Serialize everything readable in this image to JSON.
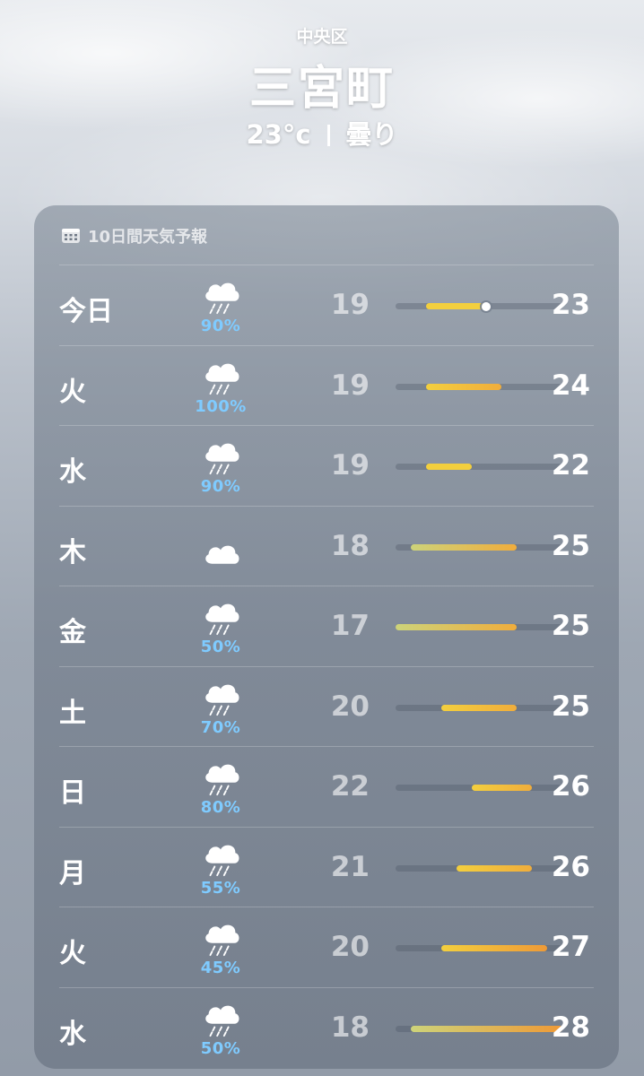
{
  "location": {
    "district": "中央区",
    "city": "三宮町",
    "temperature": "23°c",
    "condition": "曇り"
  },
  "forecast": {
    "title": "10日間天気予報",
    "icon": "calendar-icon",
    "range_min": 17,
    "range_max": 28,
    "current_temperature": 23,
    "days": [
      {
        "day": "今日",
        "icon": "cloud-rain-icon",
        "pop": "90%",
        "low": "19",
        "high": "23",
        "low_value": 19,
        "high_value": 23,
        "current": true
      },
      {
        "day": "火",
        "icon": "cloud-rain-icon",
        "pop": "100%",
        "low": "19",
        "high": "24",
        "low_value": 19,
        "high_value": 24
      },
      {
        "day": "水",
        "icon": "cloud-rain-icon",
        "pop": "90%",
        "low": "19",
        "high": "22",
        "low_value": 19,
        "high_value": 22
      },
      {
        "day": "木",
        "icon": "cloud-icon",
        "pop": "",
        "low": "18",
        "high": "25",
        "low_value": 18,
        "high_value": 25
      },
      {
        "day": "金",
        "icon": "cloud-rain-icon",
        "pop": "50%",
        "low": "17",
        "high": "25",
        "low_value": 17,
        "high_value": 25
      },
      {
        "day": "土",
        "icon": "cloud-rain-icon",
        "pop": "70%",
        "low": "20",
        "high": "25",
        "low_value": 20,
        "high_value": 25
      },
      {
        "day": "日",
        "icon": "cloud-rain-icon",
        "pop": "80%",
        "low": "22",
        "high": "26",
        "low_value": 22,
        "high_value": 26
      },
      {
        "day": "月",
        "icon": "cloud-rain-icon",
        "pop": "55%",
        "low": "21",
        "high": "26",
        "low_value": 21,
        "high_value": 26
      },
      {
        "day": "火",
        "icon": "cloud-rain-icon",
        "pop": "45%",
        "low": "20",
        "high": "27",
        "low_value": 20,
        "high_value": 27
      },
      {
        "day": "水",
        "icon": "cloud-rain-icon",
        "pop": "50%",
        "low": "18",
        "high": "28",
        "low_value": 18,
        "high_value": 28
      }
    ]
  },
  "colors": {
    "precipitation_text": "#7fcbff",
    "bar_cool": "#cdd37a",
    "bar_mild": "#f3cf3e",
    "bar_warm": "#f0ad3c",
    "bar_hot": "#ee9a37"
  }
}
